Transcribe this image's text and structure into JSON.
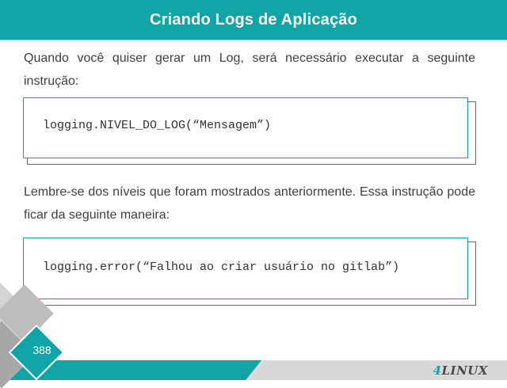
{
  "header": {
    "title": "Criando Logs de Aplicação"
  },
  "body": {
    "paragraph1": "Quando você quiser gerar um Log, será necessário executar a seguinte instrução:",
    "code1": "logging.NIVEL_DO_LOG(“Mensagem”)",
    "paragraph2": "Lembre-se dos níveis que foram mostrados anteriormente. Essa instrução pode ficar da seguinte maneira:",
    "code2": "logging.error(“Falhou ao criar usuário no gitlab”)"
  },
  "footer": {
    "page_number": "388",
    "logo_prefix": "4",
    "logo_text": "LINUX"
  },
  "colors": {
    "accent": "#11a4a7",
    "text": "#404040",
    "code_border_front": "#15a3a6",
    "code_border_back": "#6a6a6a"
  }
}
